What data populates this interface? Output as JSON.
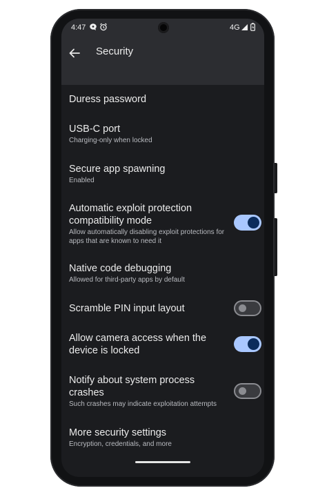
{
  "status_bar": {
    "time": "4:47",
    "network": "4G",
    "icons": [
      "chat-bubble-icon",
      "alarm-icon",
      "signal-icon",
      "battery-icon"
    ]
  },
  "app_bar": {
    "title": "Security",
    "back_icon": "arrow-back-icon"
  },
  "colors": {
    "background": "#1b1c1f",
    "appbar": "#2c2d31",
    "toggle_on_track": "#a9c7ff",
    "toggle_on_knob": "#0b2c5c",
    "toggle_off_border": "#8b8c91"
  },
  "settings": {
    "duress": {
      "title": "Duress password"
    },
    "usbc": {
      "title": "USB-C port",
      "subtitle": "Charging-only when locked"
    },
    "spawning": {
      "title": "Secure app spawning",
      "subtitle": "Enabled"
    },
    "exploit": {
      "title": "Automatic exploit protection compatibility mode",
      "subtitle": "Allow automatically disabling exploit protections for apps that are known to need it",
      "toggle": true
    },
    "native": {
      "title": "Native code debugging",
      "subtitle": "Allowed for third-party apps by default"
    },
    "scramble": {
      "title": "Scramble PIN input layout",
      "toggle": false
    },
    "camera": {
      "title": "Allow camera access when the device is locked",
      "toggle": true
    },
    "crashes": {
      "title": "Notify about system process crashes",
      "subtitle": "Such crashes may indicate exploitation attempts",
      "toggle": false
    },
    "more": {
      "title": "More security settings",
      "subtitle": "Encryption, credentials, and more"
    }
  }
}
